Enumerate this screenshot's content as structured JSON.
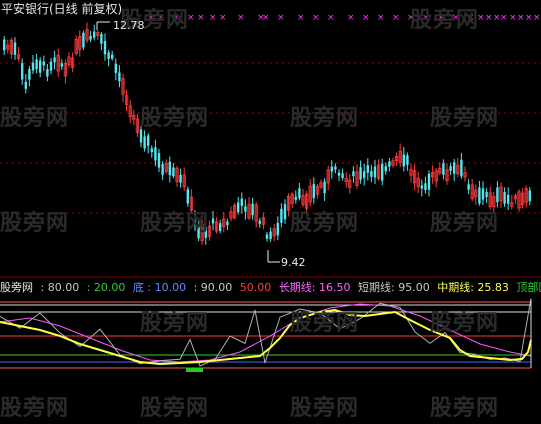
{
  "header": {
    "title": "平安银行(日线 前复权)"
  },
  "price_labels": {
    "high": "12.78",
    "low": "9.42"
  },
  "watermark": "股旁网",
  "indicator": {
    "name": "股旁网",
    "params": [
      {
        "text": ": 80.00",
        "color": "#c8c8c8"
      },
      {
        "text": ": 20.00",
        "color": "#33cc33"
      },
      {
        "text": "底",
        "color": "#5b8cff"
      },
      {
        "text": ": 10.00",
        "color": "#5b8cff"
      },
      {
        "text": ": 90.00",
        "color": "#c8c8c8"
      },
      {
        "text": "50.00",
        "color": "#ff3b3b"
      },
      {
        "text": "长期线: 16.50",
        "color": "#ff66ff"
      },
      {
        "text": "短期线: 95.00",
        "color": "#c8c8c8"
      },
      {
        "text": "中期线: 25.83",
        "color": "#ffff55"
      },
      {
        "text": "顶部区域",
        "color": "#33cc33"
      }
    ]
  },
  "colors": {
    "up": "#ff3b3b",
    "down": "#55e6f0",
    "grid": "#aa0000",
    "marker": "#ff33ff",
    "long_line": "#ff55ff",
    "short_line": "#b0b0b0",
    "mid_line": "#ffff44",
    "level_90": "#dddddd",
    "level_80": "#dddddd",
    "level_50": "#ff3333",
    "level_20": "#33cc33",
    "level_10": "#4466ff",
    "bottom_marker": "#22cc22"
  }
}
